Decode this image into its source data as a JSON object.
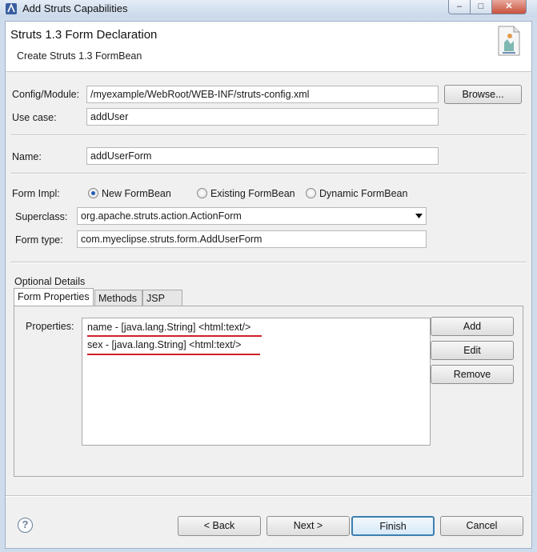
{
  "window": {
    "title": "Add Struts Capabilities",
    "controls": {
      "minimize": "–",
      "maximize": "□",
      "close": "✕"
    }
  },
  "header": {
    "title": "Struts 1.3 Form Declaration",
    "subtitle": "Create Struts 1.3 FormBean",
    "icon": "struts-wizard-icon"
  },
  "config": {
    "label": "Config/Module:",
    "value": "/myexample/WebRoot/WEB-INF/struts-config.xml",
    "browse_label": "Browse..."
  },
  "use_case": {
    "label": "Use case:",
    "value": "addUser"
  },
  "name": {
    "label": "Name:",
    "value": "addUserForm"
  },
  "form_impl": {
    "label": "Form Impl:",
    "options": [
      {
        "label": "New FormBean",
        "selected": true
      },
      {
        "label": "Existing FormBean",
        "selected": false
      },
      {
        "label": "Dynamic FormBean",
        "selected": false
      }
    ]
  },
  "superclass": {
    "label": "Superclass:",
    "value": "org.apache.struts.action.ActionForm"
  },
  "form_type": {
    "label": "Form type:",
    "value": "com.myeclipse.struts.form.AddUserForm"
  },
  "optional": {
    "label": "Optional Details",
    "tabs": [
      {
        "label": "Form Properties",
        "active": true
      },
      {
        "label": "Methods",
        "active": false
      },
      {
        "label": "JSP",
        "active": false
      }
    ],
    "properties_label": "Properties:",
    "properties": [
      "name - [java.lang.String] <html:text/>",
      "sex - [java.lang.String] <html:text/>"
    ],
    "buttons": {
      "add": "Add",
      "edit": "Edit",
      "remove": "Remove"
    }
  },
  "footer": {
    "back": "< Back",
    "next": "Next >",
    "finish": "Finish",
    "cancel": "Cancel",
    "help_icon": "question-mark-icon"
  },
  "colors": {
    "annotation_underline": "#d0202a",
    "default_button_border": "#3c7fb1"
  }
}
